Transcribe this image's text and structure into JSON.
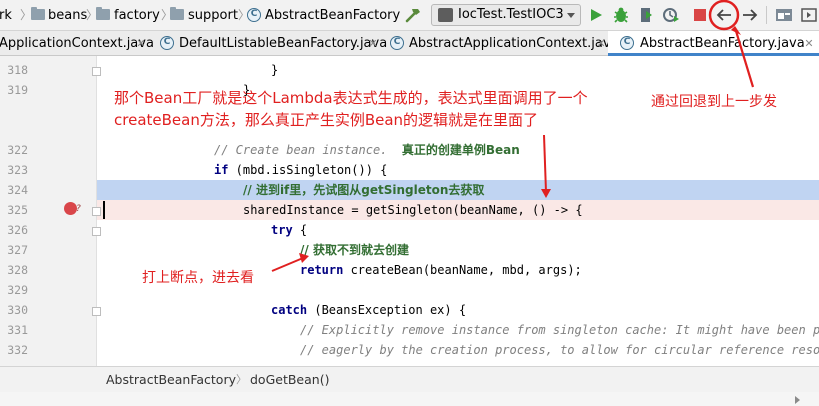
{
  "navbar": {
    "breadcrumbs": [
      "rk",
      "beans",
      "factory",
      "support",
      "AbstractBeanFactory"
    ],
    "run_config": "IocTest.TestIOC3",
    "icons": [
      "hammer-icon",
      "run-icon",
      "debug-icon",
      "coverage-icon",
      "profile-icon",
      "stop-icon",
      "back-icon",
      "forward-icon",
      "project-structure-icon",
      "more-icon"
    ]
  },
  "tabs": [
    {
      "label": "ApplicationContext.java",
      "active": false
    },
    {
      "label": "DefaultListableBeanFactory.java",
      "active": false
    },
    {
      "label": "AbstractApplicationContext.java",
      "active": false
    },
    {
      "label": "AbstractBeanFactory.java",
      "active": true
    }
  ],
  "editor": {
    "lines": [
      {
        "num": "318",
        "code": "}",
        "indent": 10
      },
      {
        "num": "319",
        "code": "}",
        "indent": 9
      },
      {
        "num": "322",
        "comment": "// Create bean instance.  ",
        "comment_cn": "真正的创建单例Bean",
        "indent": 8
      },
      {
        "num": "323",
        "code_kw": "if",
        "code": " (mbd.isSingleton()) {",
        "indent": 8
      },
      {
        "num": "324",
        "comment_cn_full": "// 进到if里，先试图从getSingleton去获取",
        "indent": 10
      },
      {
        "num": "325",
        "code": "sharedInstance = getSingleton(beanName, () -> {",
        "indent": 10
      },
      {
        "num": "326",
        "code_kw": "try",
        "code": " {",
        "indent": 12
      },
      {
        "num": "327",
        "comment_cn_full": "// 获取不到就去创建",
        "indent": 14
      },
      {
        "num": "328",
        "code_kw": "return",
        "code": " createBean(beanName, mbd, args);",
        "indent": 14
      },
      {
        "num": "329",
        "code": "",
        "indent": 12
      },
      {
        "num": "330",
        "code_kw": "catch",
        "code": " (BeansException ex) {",
        "indent": 12
      },
      {
        "num": "331",
        "comment": "// Explicitly remove instance from singleton cache: It might have been put",
        "indent": 14
      },
      {
        "num": "332",
        "comment": "// eagerly by the creation process, to allow for circular reference resolut",
        "indent": 14
      }
    ]
  },
  "annotations": {
    "main_line1": "那个Bean工厂就是这个Lambda表达式生成的，表达式里面调用了一个",
    "main_line2": "createBean方法，那么真正产生实例Bean的逻辑就是在里面了",
    "back_note": "通过回退到上一步发",
    "breakpoint_note": "打上断点，进去看",
    "color": "#e02020"
  },
  "footer": {
    "items": [
      "AbstractBeanFactory",
      "doGetBean()"
    ]
  }
}
